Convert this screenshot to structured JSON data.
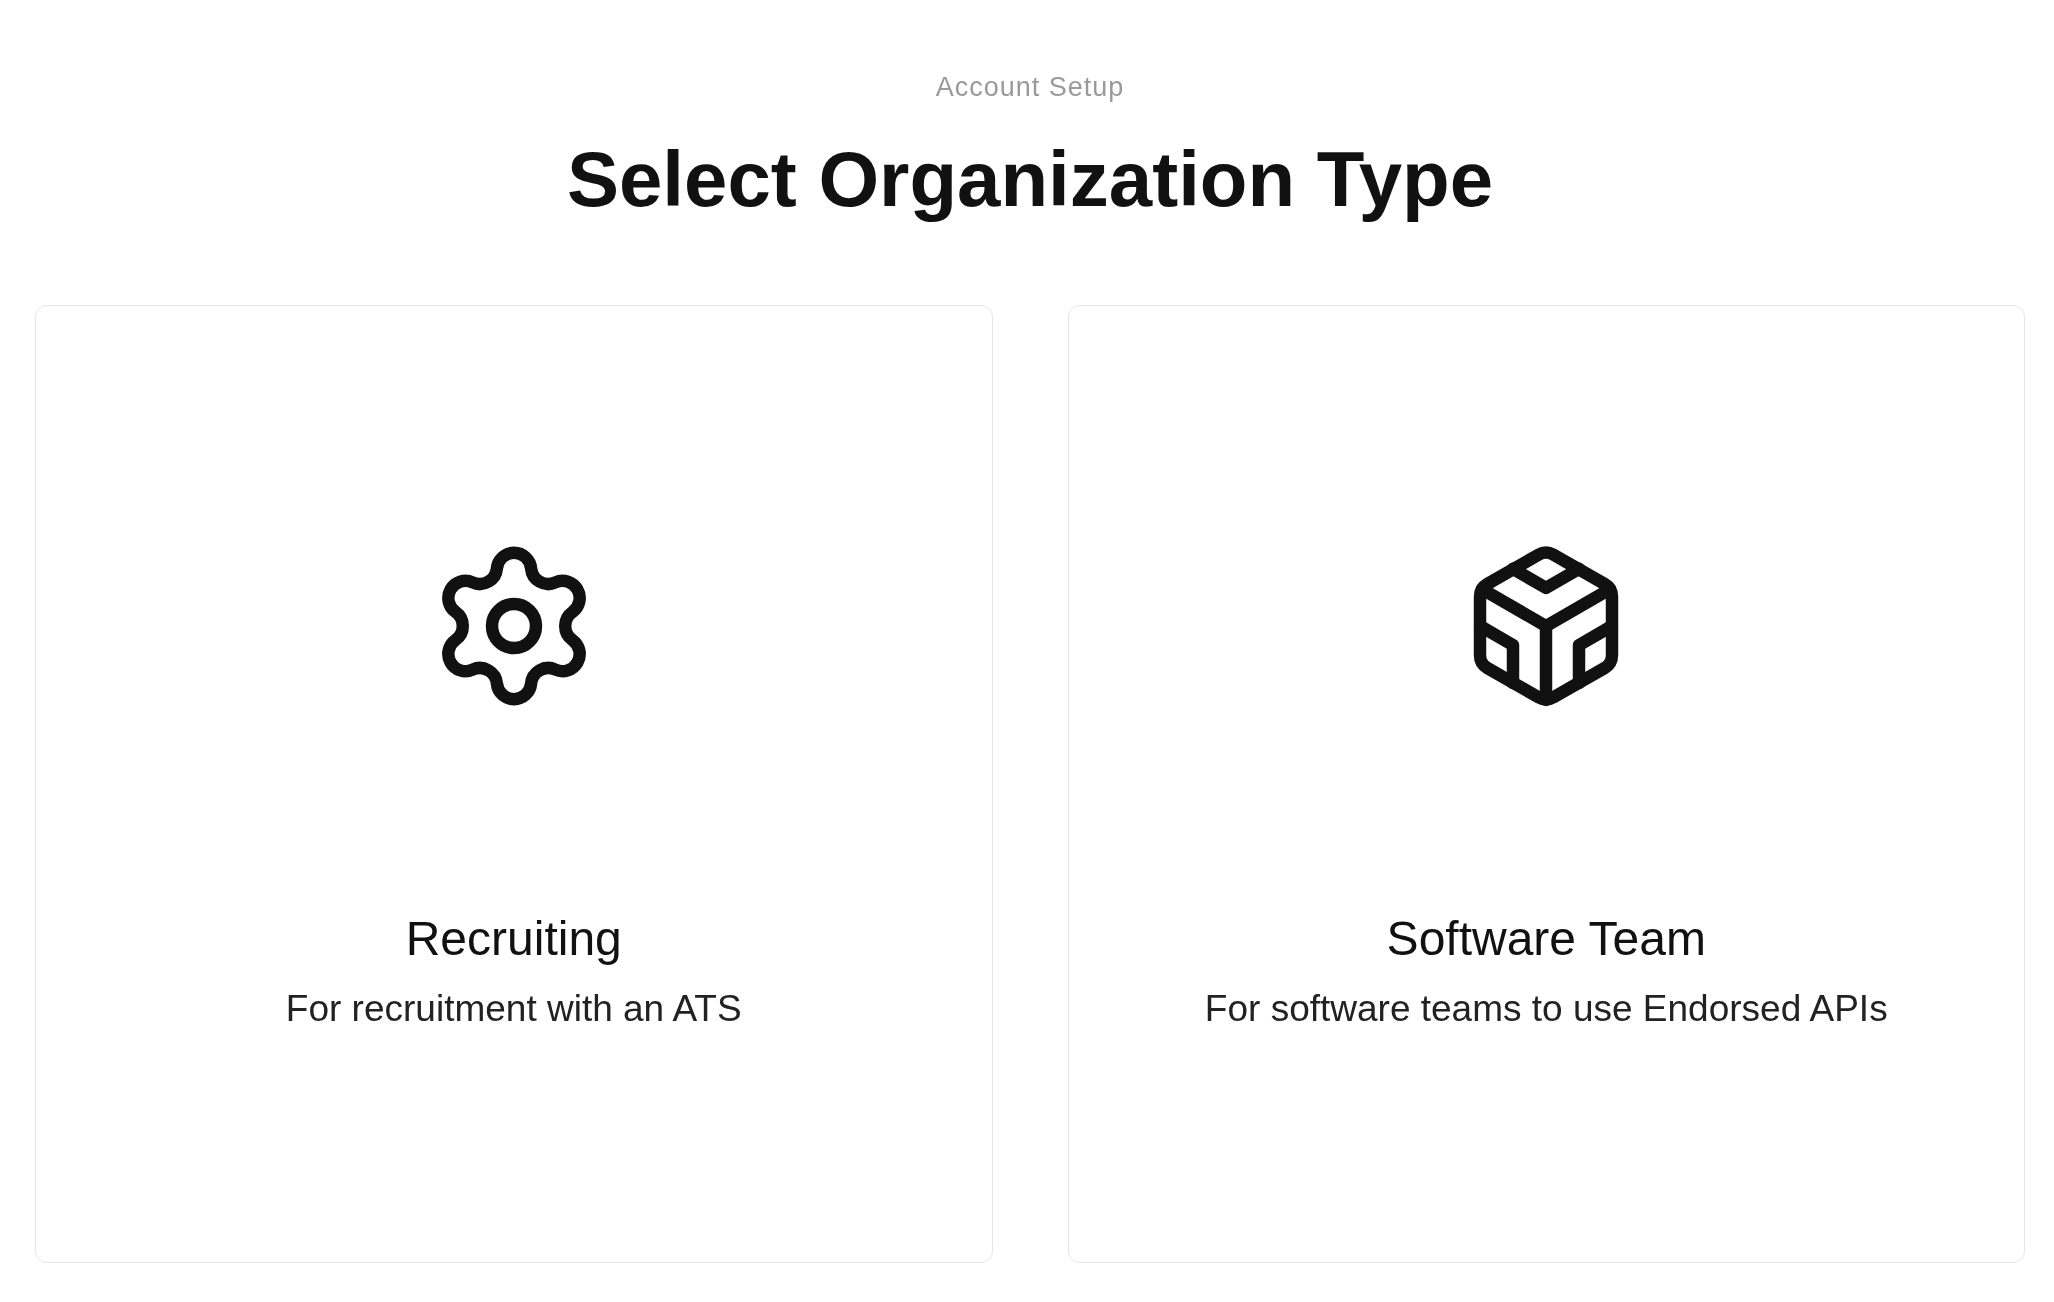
{
  "eyebrow": "Account Setup",
  "title": "Select Organization Type",
  "options": [
    {
      "kind": "gear",
      "title": "Recruiting",
      "description": "For recruitment with an ATS"
    },
    {
      "kind": "cube",
      "title": "Software Team",
      "description": "For software teams to use Endorsed APIs"
    }
  ]
}
